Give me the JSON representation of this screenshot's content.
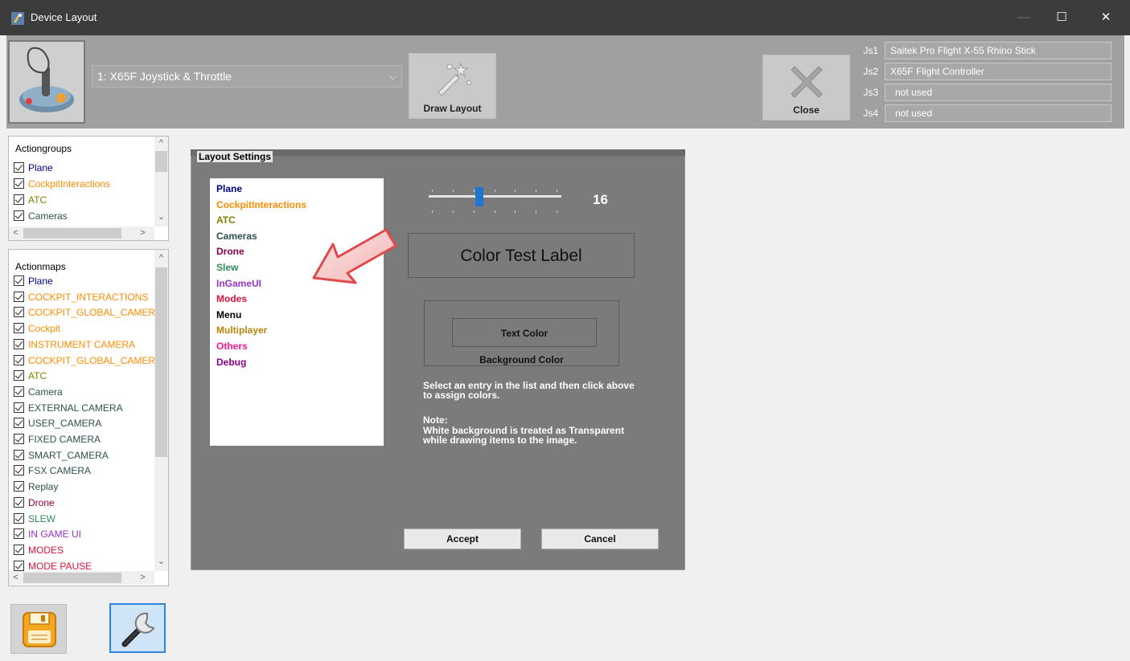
{
  "window": {
    "title": "Device Layout",
    "controls": {
      "minimize": "—",
      "maximize": "☐",
      "close": "✕"
    }
  },
  "header": {
    "device_select": "1: X65F Joystick & Throttle",
    "draw_layout": "Draw Layout",
    "close": "Close",
    "joysticks": [
      {
        "label": "Js1",
        "value": "Saitek Pro Flight X-55 Rhino Stick"
      },
      {
        "label": "Js2",
        "value": "X65F Flight Controller"
      },
      {
        "label": "Js3",
        "value": "not used"
      },
      {
        "label": "Js4",
        "value": "not used"
      }
    ]
  },
  "actiongroups": {
    "title": "Actiongroups",
    "items": [
      {
        "label": "Plane",
        "color": "#000080"
      },
      {
        "label": "CockpitInteractions",
        "color": "#ff8c00"
      },
      {
        "label": "ATC",
        "color": "#808000"
      },
      {
        "label": "Cameras",
        "color": "#2f4f4f"
      }
    ]
  },
  "actionmaps": {
    "title": "Actionmaps",
    "items": [
      {
        "label": "Plane",
        "color": "#000080"
      },
      {
        "label": "COCKPIT_INTERACTIONS",
        "color": "#ff8c00"
      },
      {
        "label": "COCKPIT_GLOBAL_CAMER",
        "color": "#ff8c00"
      },
      {
        "label": "Cockpit",
        "color": "#ff8c00"
      },
      {
        "label": "INSTRUMENT CAMERA",
        "color": "#ff8c00"
      },
      {
        "label": "COCKPIT_GLOBAL_CAMER",
        "color": "#ff8c00"
      },
      {
        "label": "ATC",
        "color": "#808000"
      },
      {
        "label": "Camera",
        "color": "#2f4f4f"
      },
      {
        "label": "EXTERNAL CAMERA",
        "color": "#2f4f4f"
      },
      {
        "label": "USER_CAMERA",
        "color": "#2f4f4f"
      },
      {
        "label": "FIXED CAMERA",
        "color": "#2f4f4f"
      },
      {
        "label": "SMART_CAMERA",
        "color": "#2f4f4f"
      },
      {
        "label": "FSX CAMERA",
        "color": "#2f4f4f"
      },
      {
        "label": "Replay",
        "color": "#2f4f4f"
      },
      {
        "label": "Drone",
        "color": "#8b0045"
      },
      {
        "label": "SLEW",
        "color": "#2e8b57"
      },
      {
        "label": "IN GAME UI",
        "color": "#9932cc"
      },
      {
        "label": "MODES",
        "color": "#dc143c"
      },
      {
        "label": "MODE PAUSE",
        "color": "#dc143c"
      }
    ]
  },
  "layout_settings": {
    "title": "Layout Settings",
    "color_list": [
      {
        "label": "Plane",
        "color": "#000080"
      },
      {
        "label": "CockpitInteractions",
        "color": "#ff8c00"
      },
      {
        "label": "ATC",
        "color": "#808000"
      },
      {
        "label": "Cameras",
        "color": "#2f4f4f"
      },
      {
        "label": "Drone",
        "color": "#8b0045"
      },
      {
        "label": "Slew",
        "color": "#2e8b57"
      },
      {
        "label": "InGameUI",
        "color": "#9932cc"
      },
      {
        "label": "Modes",
        "color": "#dc143c"
      },
      {
        "label": "Menu",
        "color": "#000000"
      },
      {
        "label": "Multiplayer",
        "color": "#b8860b"
      },
      {
        "label": "Others",
        "color": "#ff1493"
      },
      {
        "label": "Debug",
        "color": "#8b008b"
      }
    ],
    "font_size": "16",
    "font_size_fraction": 0.38,
    "test_label": "Color Test Label",
    "text_color": "Text Color",
    "background_color": "Background Color",
    "hint_1": "Select an entry in the list and then click above",
    "hint_2": "to assign colors.",
    "note_1": "Note:",
    "note_2": "White background is treated as Transparent",
    "note_3": "while drawing items to the image.",
    "accept": "Accept",
    "cancel": "Cancel"
  },
  "icons": {
    "app": "device-layout-icon",
    "joystick": "joystick-icon",
    "draw": "magic-wand-icon",
    "close": "close-x-icon",
    "save": "save-floppy-icon",
    "settings": "wrench-icon",
    "arrow": "pointer-arrow-icon"
  }
}
